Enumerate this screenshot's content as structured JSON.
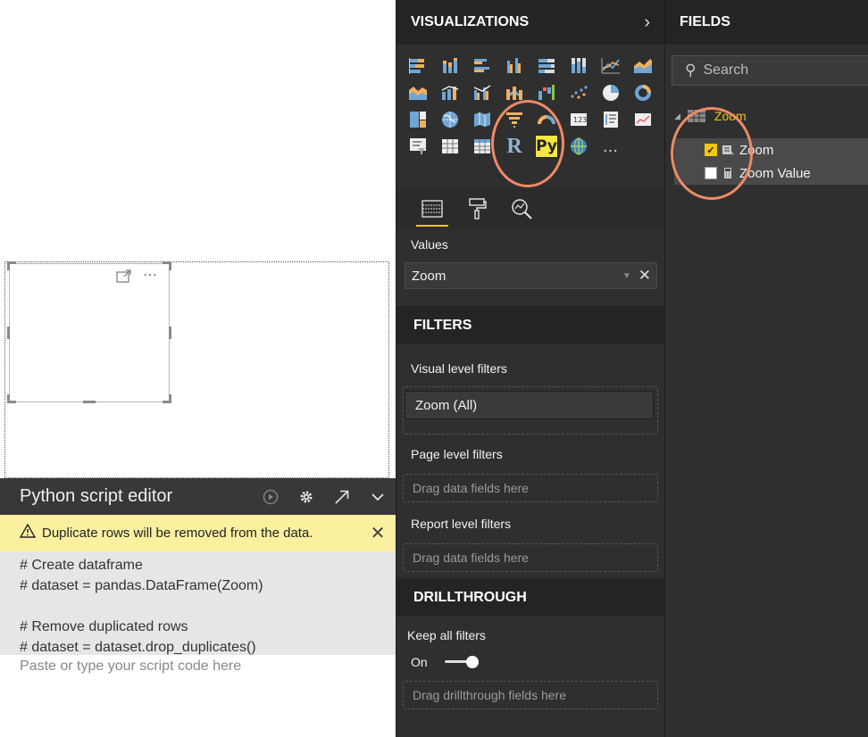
{
  "visualizations": {
    "title": "VISUALIZATIONS",
    "more_glyph": "…",
    "r_label": "R",
    "py_label": "Py",
    "values_label": "Values",
    "values_field": "Zoom",
    "filters_title": "FILTERS",
    "visual_level_label": "Visual level filters",
    "visual_filter": "Zoom  (All)",
    "page_level_label": "Page level filters",
    "page_dropzone": "Drag data fields here",
    "report_level_label": "Report level filters",
    "report_dropzone": "Drag data fields here",
    "drillthrough_title": "DRILLTHROUGH",
    "keep_all_filters_label": "Keep all filters",
    "toggle_state": "On",
    "drill_dropzone": "Drag drillthrough fields here"
  },
  "fields": {
    "title": "FIELDS",
    "search_placeholder": "Search",
    "table_name": "Zoom",
    "items": [
      {
        "label": "Zoom",
        "checked": true
      },
      {
        "label": "Zoom Value",
        "checked": false
      }
    ]
  },
  "editor": {
    "title": "Python script editor",
    "warning": "Duplicate rows will be removed from the data.",
    "code_lines": [
      "# Create dataframe",
      "# dataset = pandas.DataFrame(Zoom)",
      "",
      "# Remove duplicated rows",
      "# dataset = dataset.drop_duplicates()"
    ],
    "placeholder": "Paste or type your script code here"
  },
  "colors": {
    "accent": "#f2c811",
    "highlight_ring": "#ef8a66",
    "pane_bg": "#2f2f2f",
    "warning_bg": "#faf0a0"
  }
}
